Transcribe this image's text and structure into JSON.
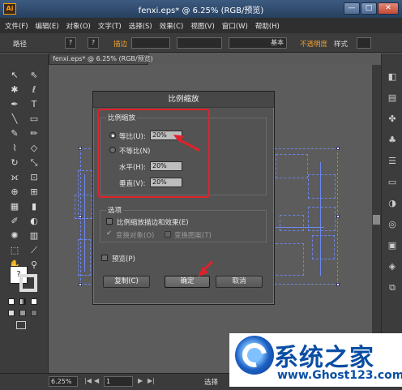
{
  "window": {
    "app_logo": "Ai",
    "title": "fenxi.eps* @ 6.25% (RGB/预览)",
    "minimize": "—",
    "maximize": "□",
    "close": "✕"
  },
  "menubar": [
    "文件(F)",
    "编辑(E)",
    "对象(O)",
    "文字(T)",
    "选择(S)",
    "效果(C)",
    "视图(V)",
    "窗口(W)",
    "帮助(H)"
  ],
  "controlbar": {
    "path_label": "路径",
    "fill_box": "?",
    "stroke_box": "?",
    "stroke_label": "描边",
    "stroke_style": "基本",
    "opacity_label": "不透明度",
    "style_label": "样式"
  },
  "document_tab": "fenxi.eps* @ 6.25% (RGB/预览)",
  "dialog": {
    "title": "比例缩放",
    "scale_group": "比例缩放",
    "uniform_label": "等比(U):",
    "uniform_value": "20%",
    "nonuniform_label": "不等比(N)",
    "horizontal_label": "水平(H):",
    "horizontal_value": "20%",
    "vertical_label": "垂直(V):",
    "vertical_value": "20%",
    "options_group": "选项",
    "scale_strokes_label": "比例缩放描边和效果(E)",
    "transform_objects_label": "变换对象(O)",
    "transform_patterns_label": "变换图案(T)",
    "preview_label": "预览(P)",
    "copy_button": "复制(C)",
    "ok_button": "确定",
    "cancel_button": "取消"
  },
  "statusbar": {
    "zoom": "6.25%",
    "artboard": "1",
    "mode": "选择"
  },
  "watermark": {
    "title": "系统之家",
    "url": "www.Ghost123.com"
  },
  "colors": {
    "annotation_red": "#e0212a",
    "selection_blue": "#6e8cff",
    "watermark_blue": "#0a4ea3"
  }
}
